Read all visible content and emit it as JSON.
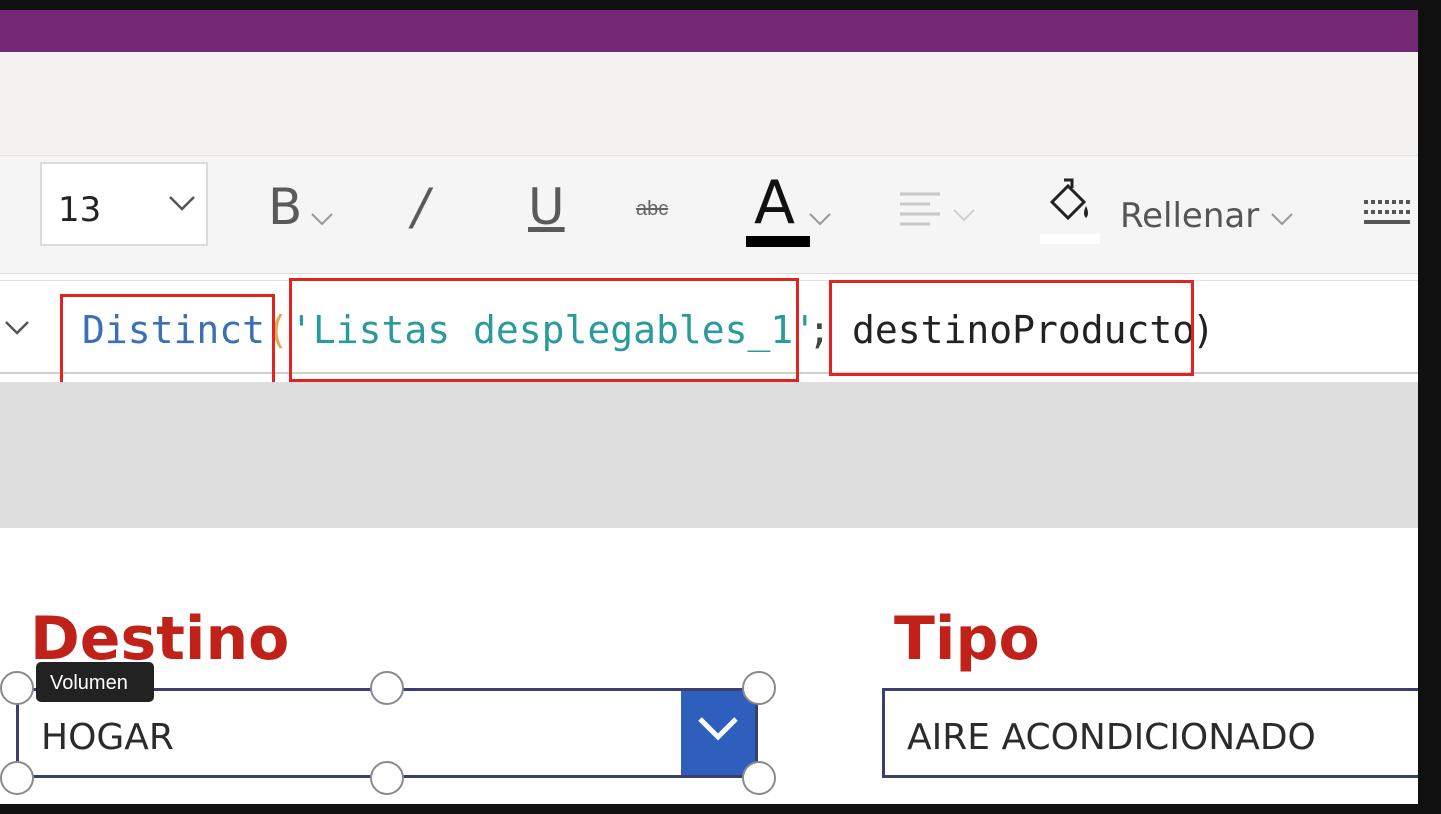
{
  "toolbar": {
    "font_size": "13",
    "bold_label": "B",
    "italic_label": "/",
    "underline_label": "U",
    "strike_label": "abc",
    "font_color_label": "A",
    "font_color_value": "#000000",
    "fill_label": "Rellenar",
    "fill_color_value": "#ffffff"
  },
  "formula": {
    "function": "Distinct",
    "open_paren": "(",
    "arg1": "'Listas desplegables_1'",
    "separator": ";",
    "arg2": "destinoProducto",
    "close_paren": ")"
  },
  "form": {
    "destino": {
      "label": "Destino",
      "value": "HOGAR"
    },
    "tipo": {
      "label": "Tipo",
      "value": "AIRE ACONDICIONADO"
    }
  },
  "tooltip": {
    "text": "Volumen"
  },
  "colors": {
    "header_purple": "#742774",
    "highlight_red": "#e0241f",
    "label_red": "#c0221a",
    "dropdown_blue": "#2e5fbd",
    "function_blue": "#3b6fb6",
    "string_teal": "#2a9a9a"
  },
  "icons": [
    "chevron-down-icon",
    "align-icon",
    "fill-bucket-icon",
    "keyboard-icon"
  ]
}
